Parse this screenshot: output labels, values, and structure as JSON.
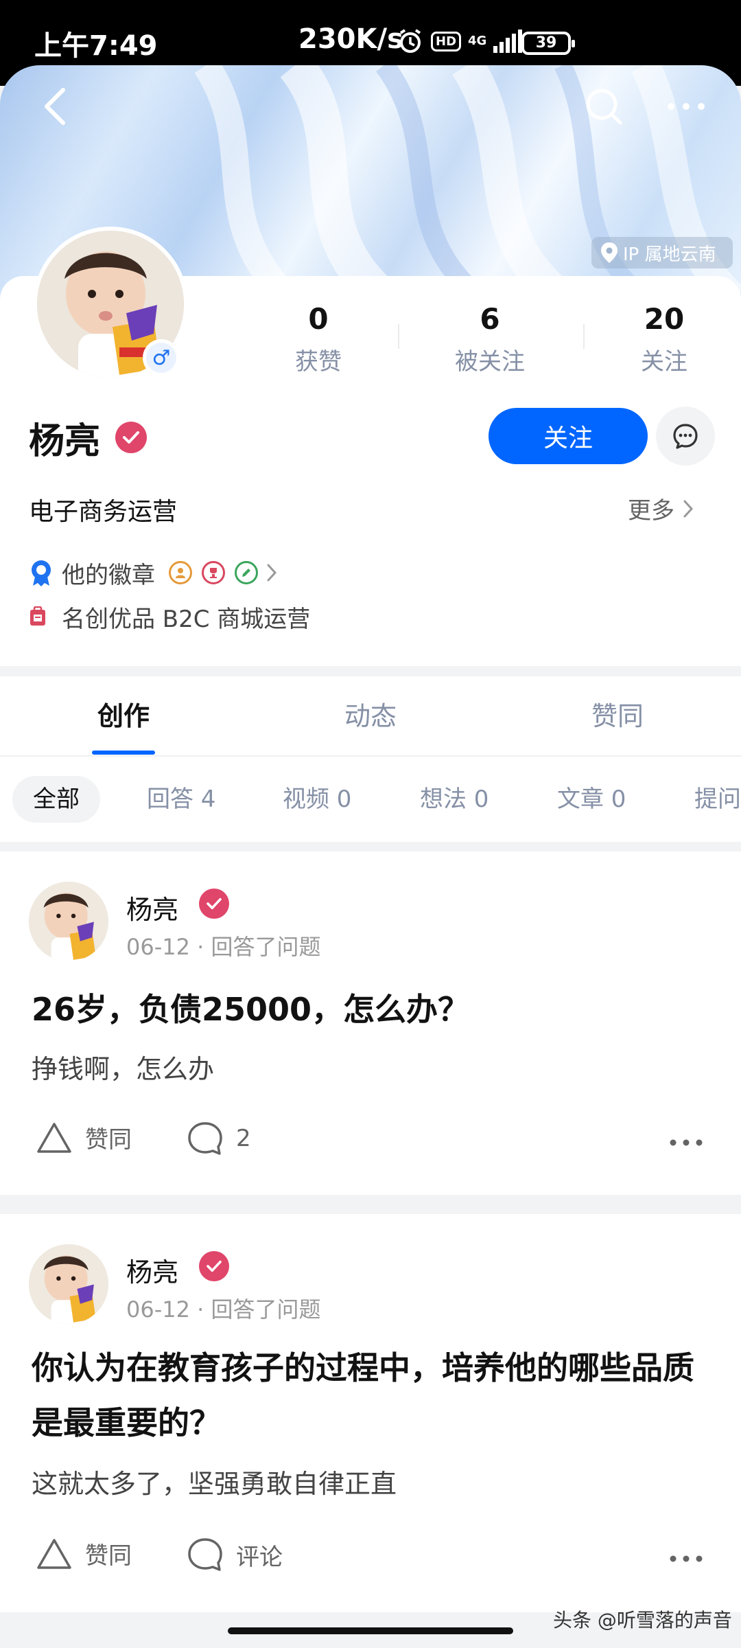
{
  "status_bar": {
    "time": "上午7:49",
    "network_speed": "230K/s",
    "hd": "HD",
    "signal_type": "4G",
    "battery": "39"
  },
  "header": {
    "ip_location": "IP 属地云南",
    "icons": [
      "back-arrow-icon",
      "search-icon",
      "more-icon"
    ]
  },
  "profile": {
    "name": "杨亮",
    "headline": "电子商务运营",
    "more_label": "更多",
    "follow_label": "关注",
    "stats": [
      {
        "num": "0",
        "label": "获赞"
      },
      {
        "num": "6",
        "label": "被关注"
      },
      {
        "num": "20",
        "label": "关注"
      }
    ],
    "badges_label": "他的徽章",
    "work": "名创优品 B2C 商城运营"
  },
  "tabs": [
    {
      "label": "创作",
      "active": true
    },
    {
      "label": "动态",
      "active": false
    },
    {
      "label": "赞同",
      "active": false
    }
  ],
  "filters": [
    {
      "label": "全部"
    },
    {
      "label": "回答 4"
    },
    {
      "label": "视频 0"
    },
    {
      "label": "想法 0"
    },
    {
      "label": "文章 0"
    },
    {
      "label": "提问"
    }
  ],
  "posts": [
    {
      "author": "杨亮",
      "meta": "06-12 · 回答了问题",
      "title": "26岁，负债25000，怎么办？",
      "body": "挣钱啊，怎么办",
      "like_label": "赞同",
      "comment_label": "2"
    },
    {
      "author": "杨亮",
      "meta": "06-12 · 回答了问题",
      "title": "你认为在教育孩子的过程中，培养他的哪些品质是最重要的？",
      "body": "这就太多了，坚强勇敢自律正直",
      "like_label": "赞同",
      "comment_label": "评论"
    }
  ],
  "watermark": "头条 @听雪落的声音",
  "colors": {
    "accent": "#0066ff",
    "verified": "#e0456a",
    "muted": "#8590a6"
  }
}
